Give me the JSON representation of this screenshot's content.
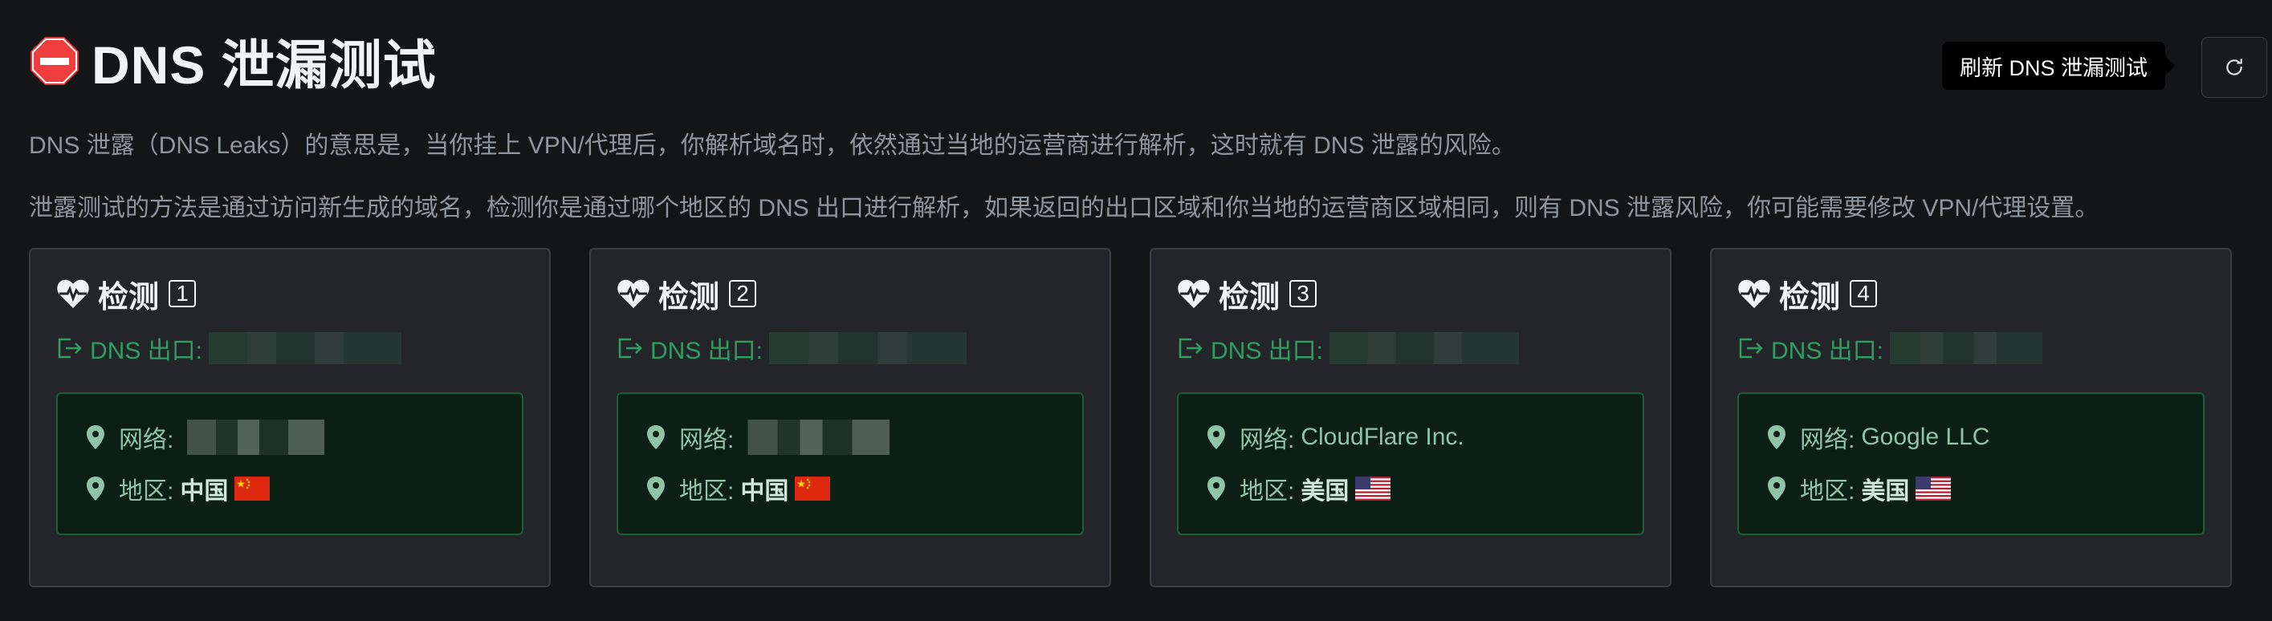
{
  "header": {
    "title": "DNS 泄漏测试",
    "stop_icon": "stop-sign-icon",
    "refresh_tooltip": "刷新 DNS 泄漏测试",
    "refresh_icon": "refresh-icon"
  },
  "description": {
    "line1": "DNS 泄露（DNS Leaks）的意思是，当你挂上 VPN/代理后，你解析域名时，依然通过当地的运营商进行解析，这时就有 DNS 泄露的风险。",
    "line2": "泄露测试的方法是通过访问新生成的域名，检测你是通过哪个地区的 DNS 出口进行解析，如果返回的出口区域和你当地的运营商区域相同，则有 DNS 泄露风险，你可能需要修改 VPN/代理设置。"
  },
  "labels": {
    "test": "检测",
    "dns_exit": "DNS 出口:",
    "network": "网络:",
    "region": "地区:"
  },
  "cards": [
    {
      "number": "1",
      "dns_exit": "",
      "network": "",
      "region": "中国",
      "flag": "cn"
    },
    {
      "number": "2",
      "dns_exit": "",
      "network": "",
      "region": "中国",
      "flag": "cn"
    },
    {
      "number": "3",
      "dns_exit": "",
      "network": "CloudFlare Inc.",
      "region": "美国",
      "flag": "us"
    },
    {
      "number": "4",
      "dns_exit": "",
      "network": "Google LLC",
      "region": "美国",
      "flag": "us"
    }
  ],
  "colors": {
    "background": "#141517",
    "card_bg": "#232529",
    "accent_green": "#2f9e63",
    "info_box_bg": "#0b1f15",
    "info_box_border": "#1e5d3a"
  }
}
